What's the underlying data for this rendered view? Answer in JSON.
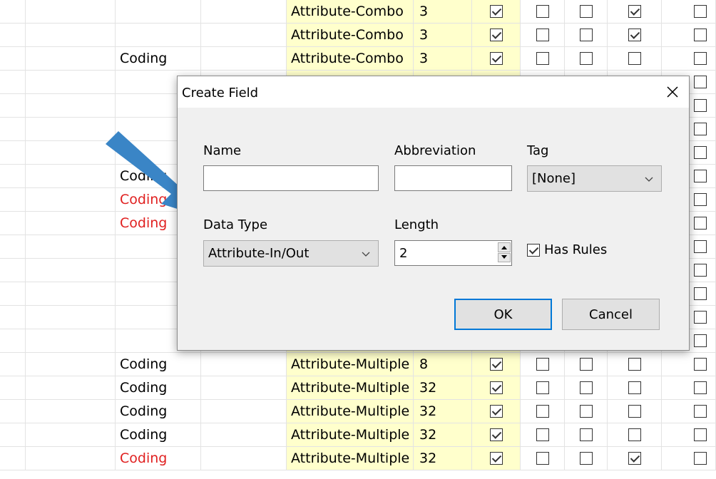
{
  "grid": {
    "rows": [
      {
        "c2": "",
        "c2_red": false,
        "c4": "Attribute-Combo",
        "c5": "3",
        "ck": [
          true,
          false,
          false,
          true,
          false
        ]
      },
      {
        "c2": "",
        "c2_red": false,
        "c4": "Attribute-Combo",
        "c5": "3",
        "ck": [
          true,
          false,
          false,
          true,
          false
        ]
      },
      {
        "c2": "Coding",
        "c2_red": false,
        "c4": "Attribute-Combo",
        "c5": "3",
        "ck": [
          true,
          false,
          false,
          false,
          false
        ]
      },
      {
        "c2": "",
        "c2_red": false,
        "c4": "",
        "c5": "",
        "ck": [
          false,
          false,
          false,
          false,
          false
        ]
      },
      {
        "c2": "",
        "c2_red": false,
        "c4": "",
        "c5": "",
        "ck": [
          false,
          false,
          false,
          false,
          false
        ]
      },
      {
        "c2": "",
        "c2_red": false,
        "c4": "",
        "c5": "",
        "ck": [
          false,
          false,
          false,
          false,
          false
        ]
      },
      {
        "c2": "",
        "c2_red": false,
        "c4": "",
        "c5": "",
        "ck": [
          false,
          false,
          false,
          false,
          false
        ]
      },
      {
        "c2": "Coding",
        "c2_red": false,
        "c4": "",
        "c5": "",
        "ck": [
          false,
          false,
          false,
          false,
          false
        ]
      },
      {
        "c2": "Coding",
        "c2_red": true,
        "c4": "",
        "c5": "",
        "ck": [
          false,
          false,
          false,
          false,
          false
        ]
      },
      {
        "c2": "Coding",
        "c2_red": true,
        "c4": "",
        "c5": "",
        "ck": [
          false,
          false,
          false,
          false,
          false
        ]
      },
      {
        "c2": "",
        "c2_red": false,
        "c4": "",
        "c5": "",
        "ck": [
          false,
          false,
          false,
          false,
          false
        ]
      },
      {
        "c2": "",
        "c2_red": false,
        "c4": "",
        "c5": "",
        "ck": [
          false,
          false,
          false,
          false,
          false
        ]
      },
      {
        "c2": "",
        "c2_red": false,
        "c4": "",
        "c5": "",
        "ck": [
          false,
          false,
          false,
          false,
          false
        ]
      },
      {
        "c2": "",
        "c2_red": false,
        "c4": "",
        "c5": "",
        "ck": [
          false,
          false,
          false,
          false,
          false
        ]
      },
      {
        "c2": "",
        "c2_red": false,
        "c4": "",
        "c5": "",
        "ck": [
          false,
          false,
          false,
          false,
          false
        ]
      },
      {
        "c2": "Coding",
        "c2_red": false,
        "c4": "Attribute-Multiple",
        "c5": "8",
        "ck": [
          true,
          false,
          false,
          false,
          false
        ]
      },
      {
        "c2": "Coding",
        "c2_red": false,
        "c4": "Attribute-Multiple",
        "c5": "32",
        "ck": [
          true,
          false,
          false,
          false,
          false
        ]
      },
      {
        "c2": "Coding",
        "c2_red": false,
        "c4": "Attribute-Multiple",
        "c5": "32",
        "ck": [
          true,
          false,
          false,
          false,
          false
        ]
      },
      {
        "c2": "Coding",
        "c2_red": false,
        "c4": "Attribute-Multiple",
        "c5": "32",
        "ck": [
          true,
          false,
          false,
          false,
          false
        ]
      },
      {
        "c2": "Coding",
        "c2_red": true,
        "c4": "Attribute-Multiple",
        "c5": "32",
        "ck": [
          true,
          false,
          false,
          true,
          false
        ]
      }
    ],
    "red_color": "#e02020",
    "highlight_color": "#ffffcc"
  },
  "annotation": {
    "arrow_color": "#3a85c6",
    "icon": "arrow-icon"
  },
  "dialog": {
    "title": "Create Field",
    "close_icon": "close-icon",
    "name_label": "Name",
    "name_value": "",
    "abbreviation_label": "Abbreviation",
    "abbreviation_value": "",
    "tag_label": "Tag",
    "tag_value": "[None]",
    "data_type_label": "Data Type",
    "data_type_value": "Attribute-In/Out",
    "length_label": "Length",
    "length_value": "2",
    "has_rules_label": "Has Rules",
    "has_rules_checked": true,
    "ok_label": "OK",
    "cancel_label": "Cancel",
    "accent_color": "#0078d7"
  }
}
